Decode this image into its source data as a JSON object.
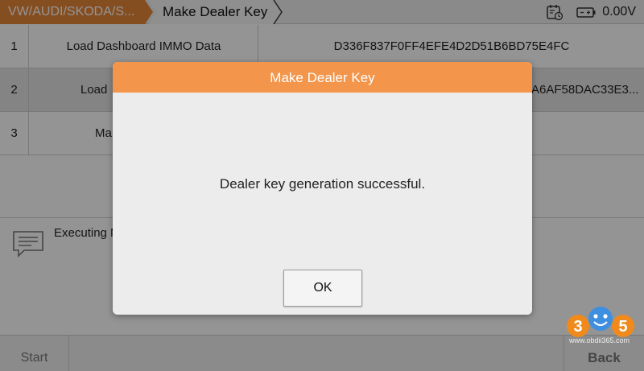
{
  "breadcrumb": {
    "path": "VW/AUDI/SKODA/S...",
    "current": "Make Dealer Key"
  },
  "status": {
    "voltage": "0.00V",
    "icons": [
      "calendar-clock-icon",
      "battery-icon"
    ]
  },
  "table": {
    "rows": [
      {
        "index": "1",
        "name": "Load Dashboard IMMO Data",
        "value": "D336F837F0FF4EFE4D2D51B6BD75E4FC"
      },
      {
        "index": "2",
        "name": "Load",
        "value": "A6AF58DAC33E3..."
      },
      {
        "index": "3",
        "name": "Ma",
        "value": ""
      }
    ]
  },
  "info": {
    "icon": "message-icon",
    "text": "Executing M"
  },
  "footer": {
    "start_label": "Start",
    "back_label": "Back"
  },
  "dialog": {
    "title": "Make Dealer Key",
    "message": "Dealer key generation successful.",
    "ok_label": "OK"
  },
  "watermark": {
    "digits": "3 5",
    "url": "www.obdii365.com"
  },
  "colors": {
    "accent": "#e6873a",
    "dialog_header": "#f3954a"
  }
}
